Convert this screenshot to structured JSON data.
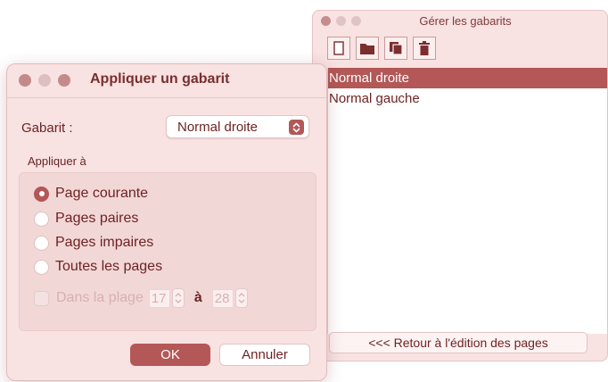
{
  "manage_window": {
    "title": "Gérer les gabarits",
    "toolbar": {
      "icons": [
        "new-document-icon",
        "folder-icon",
        "duplicate-icon",
        "trash-icon"
      ]
    },
    "templates": [
      {
        "label": "Normal droite",
        "selected": true
      },
      {
        "label": "Normal gauche",
        "selected": false
      }
    ],
    "back_button_label": "<<< Retour à l'édition des pages"
  },
  "apply_dialog": {
    "title": "Appliquer un gabarit",
    "gabarit_label": "Gabarit :",
    "gabarit_value": "Normal droite",
    "apply_to_label": "Appliquer à",
    "options": [
      {
        "label": "Page courante",
        "checked": true
      },
      {
        "label": "Pages paires",
        "checked": false
      },
      {
        "label": "Pages impaires",
        "checked": false
      },
      {
        "label": "Toutes les pages",
        "checked": false
      }
    ],
    "range": {
      "label": "Dans la plage",
      "from": "17",
      "to_label": "à",
      "to": "28",
      "enabled": false
    },
    "ok_label": "OK",
    "cancel_label": "Annuler"
  },
  "colors": {
    "accent": "#b35757",
    "window_bg": "#f8e2e2",
    "text": "#6e2323"
  }
}
